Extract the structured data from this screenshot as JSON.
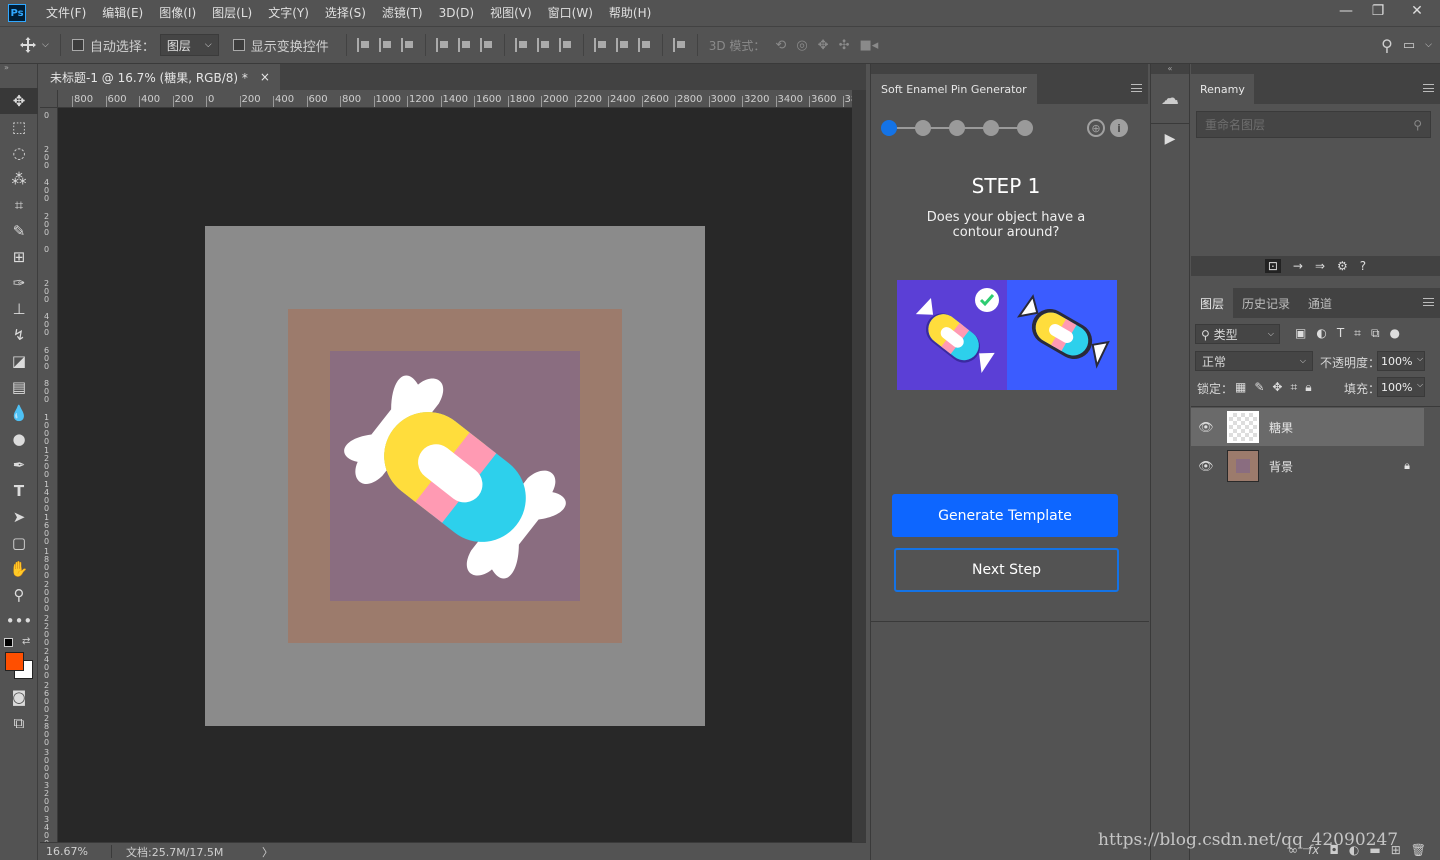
{
  "menubar": {
    "logo": "Ps",
    "items": [
      "文件(F)",
      "编辑(E)",
      "图像(I)",
      "图层(L)",
      "文字(Y)",
      "选择(S)",
      "滤镜(T)",
      "3D(D)",
      "视图(V)",
      "窗口(W)",
      "帮助(H)"
    ],
    "window_controls": {
      "minimize": "—",
      "restore": "❐",
      "close": "✕"
    }
  },
  "options": {
    "auto_select_label": "自动选择：",
    "auto_select_target": "图层",
    "show_transform_label": "显示变换控件",
    "mode_3d_label": "3D 模式："
  },
  "document": {
    "tab_title": "未标题-1 @ 16.7% (糖果, RGB/8) *",
    "close": "×",
    "zoom": "16.67%",
    "doc_size": "文档:25.7M/17.5M",
    "arrow": "〉"
  },
  "rulers": {
    "horizontal": [
      "800",
      "600",
      "400",
      "200",
      "0",
      "200",
      "400",
      "600",
      "800",
      "1000",
      "1200",
      "1400",
      "1600",
      "1800",
      "2000",
      "2200",
      "2400",
      "2600",
      "2800",
      "3000",
      "3200",
      "3400",
      "3600",
      "38"
    ],
    "vertical": [
      "0",
      "2 0 0",
      "4 0 0",
      "2 0 0",
      "0",
      "2 0 0",
      "4 0 0",
      "6 0 0",
      "8 0 0",
      "1 0 0 0",
      "1 2 0 0",
      "1 4 0 0",
      "1 6 0 0",
      "1 8 0 0",
      "2 0 0 0",
      "2 2 0 0",
      "2 4 0 0",
      "2 6 0 0",
      "2 8 0 0",
      "3 0 0 0",
      "3 2 0 0",
      "3 4 0 0",
      "3 6 0 0"
    ]
  },
  "colors": {
    "canvas_bg": "#8b8b8b",
    "border_frame": "#9c7b6c",
    "inner_square": "#8a6d80",
    "candy_yellow": "#ffdd3c",
    "candy_pink": "#ff9ab3",
    "candy_cyan": "#2dd0ec",
    "foreground": "#ff4f00",
    "background": "#ffffff",
    "accent_blue": "#0d66ff"
  },
  "plugin": {
    "title": "Soft Enamel Pin Generator",
    "step_title": "STEP 1",
    "question": "Does your object have a contour around?",
    "generate_label": "Generate Template",
    "next_label": "Next Step",
    "steps_total": 5,
    "current_step": 1
  },
  "renamy": {
    "tab": "Renamy",
    "placeholder": "重命名图层"
  },
  "layers_panel": {
    "tabs": [
      "图层",
      "历史记录",
      "通道"
    ],
    "filter_label": "类型",
    "blend_mode": "正常",
    "opacity_label": "不透明度：",
    "opacity_value": "100%",
    "lock_label": "锁定：",
    "fill_label": "填充：",
    "fill_value": "100%",
    "layers": [
      {
        "name": "糖果",
        "selected": true
      },
      {
        "name": "背景",
        "selected": false,
        "locked": true
      }
    ]
  },
  "watermark": "https://blog.csdn.net/qq_42090247"
}
